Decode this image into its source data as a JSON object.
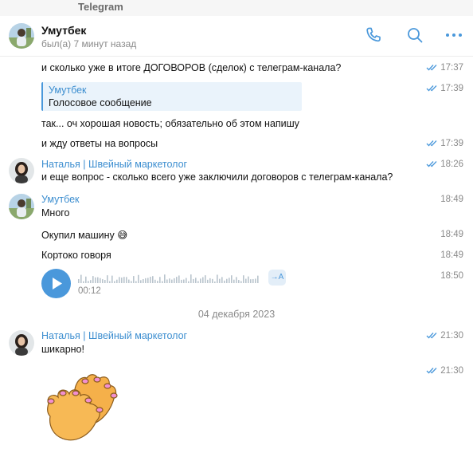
{
  "app": {
    "title": "Telegram"
  },
  "header": {
    "peer_name": "Умутбек",
    "peer_status": "был(а) 7 минут назад"
  },
  "messages": [
    {
      "text": "и сколько уже в итоге ДОГОВОРОВ (сделок) с телеграм-канала?",
      "time": "17:37"
    },
    {
      "reply_name": "Умутбек",
      "reply_text": "Голосовое сообщение",
      "time": "17:39"
    },
    {
      "text": "так... оч хорошая новость; обязательно об этом напишу"
    },
    {
      "text": "и жду ответы на вопросы",
      "time": "17:39"
    },
    {
      "sender": "Наталья | Швейный маркетолог",
      "text": "и еще вопрос -  сколько всего уже заключили договоров с телеграм-канала?",
      "time": "18:26"
    },
    {
      "sender": "Умутбек",
      "text": "Много",
      "time": "18:49"
    },
    {
      "text": "Окупил машину",
      "emoji": "😅",
      "time": "18:49"
    },
    {
      "text": "Кортоко говоря",
      "time": "18:49"
    },
    {
      "voice_duration": "00:12",
      "transcribe_label": "→A",
      "time": "18:50"
    }
  ],
  "date_separator": "04 декабря 2023",
  "later_messages": [
    {
      "sender": "Наталья | Швейный маркетолог",
      "text": "шикарно!",
      "time": "21:30"
    },
    {
      "sticker": "clapping-hands",
      "time": "21:30"
    }
  ],
  "colors": {
    "accent": "#4a98db",
    "sender_name": "#3c8ed0",
    "time": "#8a8a8a",
    "reply_bg": "#eaf3fb"
  }
}
